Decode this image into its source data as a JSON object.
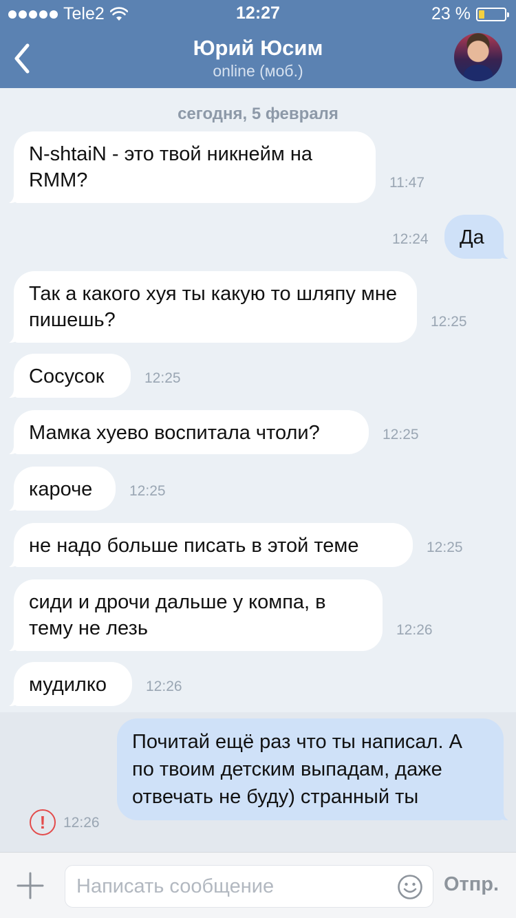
{
  "status_bar": {
    "carrier": "Tele2",
    "time": "12:27",
    "battery_percent": "23 %",
    "battery_level": 0.23
  },
  "header": {
    "contact_name": "Юрий Юсим",
    "status": "online (моб.)"
  },
  "chat": {
    "date_separator": "сегодня, 5 февраля",
    "messages": [
      {
        "direction": "in",
        "text": "N-shtaiN - это твой никнейм на RMM?",
        "time": "11:47"
      },
      {
        "direction": "out",
        "text": "Да",
        "time": "12:24"
      },
      {
        "direction": "in",
        "text": "Так а какого хуя ты какую то шляпу мне пишешь?",
        "time": "12:25"
      },
      {
        "direction": "in",
        "text": "Сосусок",
        "time": "12:25"
      },
      {
        "direction": "in",
        "text": "Мамка хуево воспитала чтоли?",
        "time": "12:25"
      },
      {
        "direction": "in",
        "text": "кароче",
        "time": "12:25"
      },
      {
        "direction": "in",
        "text": "не надо больше писать в этой теме",
        "time": "12:25"
      },
      {
        "direction": "in",
        "text": "сиди и дрочи дальше у компа, в тему не лезь",
        "time": "12:26"
      },
      {
        "direction": "in",
        "text": "мудилко",
        "time": "12:26"
      },
      {
        "direction": "out",
        "text": "Почитай ещё раз что ты написал. А по твоим детским выпадам, даже отвечать не буду) странный ты",
        "time": "12:26",
        "status": "error"
      }
    ]
  },
  "composer": {
    "placeholder": "Написать сообщение",
    "send_label": "Отпр."
  },
  "colors": {
    "header_bg": "#5b82b2",
    "chat_bg": "#ebf0f5",
    "incoming_bubble": "#ffffff",
    "outgoing_bubble": "#cfe1f8",
    "error": "#e34b4b"
  }
}
